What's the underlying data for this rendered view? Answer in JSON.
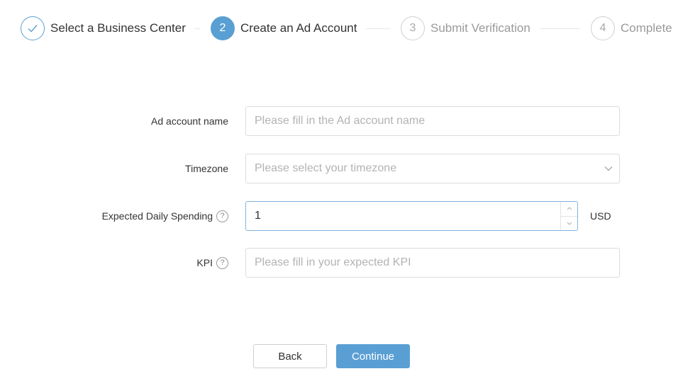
{
  "stepper": {
    "steps": [
      {
        "number": "",
        "label": "Select a Business Center",
        "state": "done",
        "icon": "check-icon"
      },
      {
        "number": "2",
        "label": "Create an Ad Account",
        "state": "active"
      },
      {
        "number": "3",
        "label": "Submit Verification",
        "state": "todo"
      },
      {
        "number": "4",
        "label": "Complete",
        "state": "todo"
      }
    ]
  },
  "form": {
    "ad_account_name": {
      "label": "Ad account name",
      "placeholder": "Please fill in the Ad account name",
      "value": ""
    },
    "timezone": {
      "label": "Timezone",
      "placeholder": "Please select your timezone",
      "icon": "chevron-down-icon"
    },
    "daily_spending": {
      "label": "Expected Daily Spending",
      "help": "?",
      "value": "1",
      "unit": "USD"
    },
    "kpi": {
      "label": "KPI",
      "help": "?",
      "placeholder": "Please fill in your expected KPI",
      "value": ""
    }
  },
  "buttons": {
    "back_label": "Back",
    "continue_label": "Continue"
  },
  "colors": {
    "accent": "#5a9fd4",
    "border": "#dcdcdc",
    "placeholder": "#b3b3b3",
    "inactive": "#9a9a9a"
  }
}
